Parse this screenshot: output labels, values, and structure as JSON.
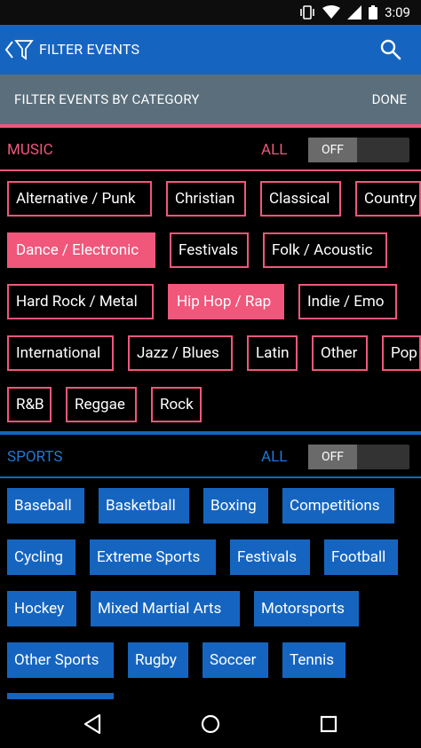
{
  "status": {
    "time": "3:09"
  },
  "appbar": {
    "title": "FILTER EVENTS"
  },
  "subheader": {
    "label": "FILTER EVENTS BY CATEGORY",
    "done": "DONE"
  },
  "music": {
    "title": "MUSIC",
    "all_label": "ALL",
    "toggle_state": "OFF",
    "accent": "#f0577b",
    "chips": [
      {
        "label": "Alternative / Punk",
        "selected": false
      },
      {
        "label": "Christian",
        "selected": false
      },
      {
        "label": "Classical",
        "selected": false
      },
      {
        "label": "Country",
        "selected": false
      },
      {
        "label": "Dance / Electronic",
        "selected": true
      },
      {
        "label": "Festivals",
        "selected": false
      },
      {
        "label": "Folk / Acoustic",
        "selected": false
      },
      {
        "label": "Hard Rock / Metal",
        "selected": false
      },
      {
        "label": "Hip Hop / Rap",
        "selected": true
      },
      {
        "label": "Indie / Emo",
        "selected": false
      },
      {
        "label": "International",
        "selected": false
      },
      {
        "label": "Jazz / Blues",
        "selected": false
      },
      {
        "label": "Latin",
        "selected": false
      },
      {
        "label": "Other",
        "selected": false
      },
      {
        "label": "Pop",
        "selected": false
      },
      {
        "label": "R&B",
        "selected": false
      },
      {
        "label": "Reggae",
        "selected": false
      },
      {
        "label": "Rock",
        "selected": false
      }
    ]
  },
  "sports": {
    "title": "SPORTS",
    "all_label": "ALL",
    "toggle_state": "OFF",
    "accent": "#1565c0",
    "chips": [
      {
        "label": "Baseball"
      },
      {
        "label": "Basketball"
      },
      {
        "label": "Boxing"
      },
      {
        "label": "Competitions"
      },
      {
        "label": "Cycling"
      },
      {
        "label": "Extreme Sports"
      },
      {
        "label": "Festivals"
      },
      {
        "label": "Football"
      },
      {
        "label": "Hockey"
      },
      {
        "label": "Mixed Martial Arts"
      },
      {
        "label": "Motorsports"
      },
      {
        "label": "Other Sports"
      },
      {
        "label": "Rugby"
      },
      {
        "label": "Soccer"
      },
      {
        "label": "Tennis"
      }
    ]
  }
}
